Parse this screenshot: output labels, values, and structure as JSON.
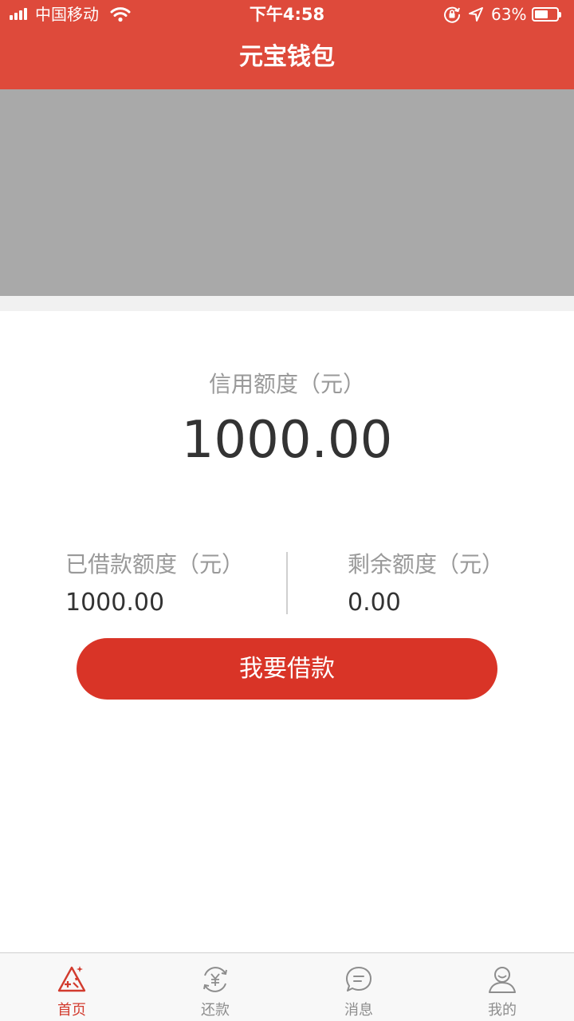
{
  "status_bar": {
    "carrier": "中国移动",
    "time": "下午4:58",
    "battery_percent": "63%",
    "battery_level": 0.63
  },
  "nav": {
    "title": "元宝钱包"
  },
  "credit": {
    "label": "信用额度（元）",
    "value": "1000.00"
  },
  "stats": {
    "borrowed_label": "已借款额度（元）",
    "borrowed_value": "1000.00",
    "remaining_label": "剩余额度（元）",
    "remaining_value": "0.00"
  },
  "borrow_button": {
    "label": "我要借款"
  },
  "tabs": [
    {
      "label": "首页",
      "icon": "home-icon",
      "active": true
    },
    {
      "label": "还款",
      "icon": "repay-yuan-icon",
      "active": false
    },
    {
      "label": "消息",
      "icon": "message-icon",
      "active": false
    },
    {
      "label": "我的",
      "icon": "profile-icon",
      "active": false
    }
  ],
  "colors": {
    "header": "#de4a3b",
    "button": "#d93427",
    "active_tab": "#d23b2e",
    "banner_placeholder": "#a9a9a9"
  }
}
